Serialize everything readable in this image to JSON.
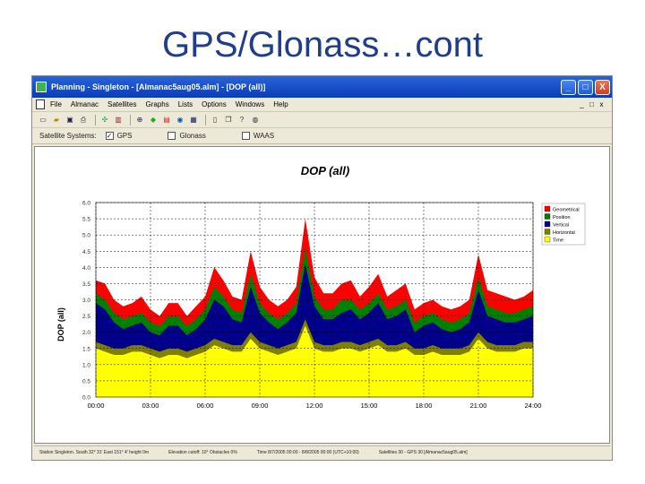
{
  "slide": {
    "title": "GPS/Glonass…cont"
  },
  "window": {
    "title": "Planning - Singleton - [Almanac5aug05.alm] - [DOP (all)]",
    "controls": [
      "_",
      "□",
      "X"
    ]
  },
  "menu": {
    "items": [
      "File",
      "Almanac",
      "Satellites",
      "Graphs",
      "Lists",
      "Options",
      "Windows",
      "Help"
    ],
    "doc_controls": [
      "_",
      "□",
      "x"
    ]
  },
  "toolbar": {
    "icons": [
      "new-icon",
      "open-icon",
      "save-icon",
      "print-icon",
      "satellite-icon",
      "number-icon",
      "sky-plot-icon",
      "elevation-icon",
      "dop-icon",
      "world-view-icon",
      "table-icon",
      "tile-icon",
      "cascade-icon",
      "help-icon",
      "about-icon"
    ]
  },
  "options": {
    "label": "Satellite Systems:",
    "systems": [
      {
        "label": "GPS",
        "checked": true
      },
      {
        "label": "Glonass",
        "checked": false
      },
      {
        "label": "WAAS",
        "checked": false
      }
    ]
  },
  "status": {
    "station": "Station Singleton. South 32° 31'  East 151° 4'  height 0m",
    "cutoff": "Elevation cutoff: 10°  Obstacles 0%",
    "time": "Time 8/7/2005 00:00 - 8/8/2005 00:00 (UTC+10:00)",
    "satellites": "Satellites 30 - GPS 30 [Almanac5aug05.alm]"
  },
  "chart_data": {
    "type": "area",
    "title": "DOP (all)",
    "xlabel": "",
    "ylabel": "DOP (all)",
    "x_ticks": [
      "00:00",
      "03:00",
      "06:00",
      "09:00",
      "12:00",
      "15:00",
      "18:00",
      "21:00",
      "24:00"
    ],
    "y_ticks": [
      "0.0",
      "0.5",
      "1.0",
      "1.5",
      "2.0",
      "2.5",
      "3.0",
      "3.5",
      "4.0",
      "4.5",
      "5.0",
      "5.5",
      "6.0"
    ],
    "ylim": [
      0,
      6
    ],
    "grid": true,
    "legend_position": "top-right",
    "x_hours": [
      0,
      0.5,
      1,
      1.5,
      2,
      2.5,
      3,
      3.5,
      4,
      4.5,
      5,
      5.5,
      6,
      6.5,
      7,
      7.5,
      8,
      8.5,
      9,
      9.5,
      10,
      10.5,
      11,
      11.5,
      12,
      12.5,
      13,
      13.5,
      14,
      14.5,
      15,
      15.5,
      16,
      16.5,
      17,
      17.5,
      18,
      18.5,
      19,
      19.5,
      20,
      20.5,
      21,
      21.5,
      22,
      22.5,
      23,
      23.5,
      24
    ],
    "series": [
      {
        "name": "Geometrical",
        "color": "#ff0000",
        "values": [
          3.6,
          3.5,
          3.0,
          2.8,
          2.9,
          3.1,
          2.7,
          2.5,
          2.9,
          2.9,
          2.5,
          2.8,
          3.1,
          4.0,
          3.6,
          3.1,
          3.0,
          4.5,
          3.4,
          3.0,
          2.8,
          3.0,
          3.4,
          5.5,
          3.7,
          3.2,
          3.2,
          3.5,
          3.6,
          3.1,
          3.4,
          3.8,
          3.1,
          3.3,
          3.5,
          2.7,
          2.9,
          3.0,
          2.8,
          2.7,
          2.8,
          3.0,
          4.4,
          3.3,
          3.2,
          3.1,
          3.0,
          3.1,
          3.3
        ]
      },
      {
        "name": "Position",
        "color": "#008000",
        "values": [
          3.2,
          3.0,
          2.6,
          2.4,
          2.5,
          2.6,
          2.3,
          2.2,
          2.5,
          2.5,
          2.2,
          2.4,
          2.7,
          3.4,
          3.1,
          2.7,
          2.6,
          3.8,
          2.9,
          2.6,
          2.4,
          2.6,
          2.9,
          4.6,
          3.1,
          2.7,
          2.7,
          3.0,
          3.0,
          2.7,
          2.9,
          3.2,
          2.7,
          2.8,
          3.0,
          2.3,
          2.5,
          2.6,
          2.4,
          2.3,
          2.4,
          2.6,
          3.7,
          2.8,
          2.7,
          2.6,
          2.6,
          2.7,
          2.8
        ]
      },
      {
        "name": "Vertical",
        "color": "#00008b",
        "values": [
          2.9,
          2.7,
          2.3,
          2.1,
          2.2,
          2.3,
          2.0,
          1.9,
          2.2,
          2.2,
          1.9,
          2.1,
          2.4,
          3.0,
          2.8,
          2.4,
          2.3,
          3.4,
          2.6,
          2.3,
          2.1,
          2.3,
          2.6,
          4.1,
          2.8,
          2.4,
          2.4,
          2.6,
          2.7,
          2.4,
          2.6,
          2.9,
          2.4,
          2.5,
          2.7,
          2.0,
          2.2,
          2.3,
          2.1,
          2.0,
          2.1,
          2.3,
          3.3,
          2.5,
          2.4,
          2.3,
          2.3,
          2.4,
          2.5
        ]
      },
      {
        "name": "Horizontal",
        "color": "#808000",
        "values": [
          1.7,
          1.6,
          1.5,
          1.5,
          1.6,
          1.6,
          1.5,
          1.4,
          1.5,
          1.5,
          1.4,
          1.5,
          1.6,
          1.8,
          1.7,
          1.6,
          1.6,
          2.0,
          1.7,
          1.6,
          1.5,
          1.6,
          1.7,
          2.4,
          1.7,
          1.6,
          1.6,
          1.7,
          1.7,
          1.6,
          1.7,
          1.8,
          1.6,
          1.6,
          1.7,
          1.5,
          1.5,
          1.6,
          1.5,
          1.5,
          1.5,
          1.6,
          2.0,
          1.7,
          1.6,
          1.6,
          1.6,
          1.7,
          1.7
        ]
      },
      {
        "name": "Time",
        "color": "#ffff00",
        "values": [
          1.5,
          1.4,
          1.3,
          1.3,
          1.4,
          1.4,
          1.3,
          1.2,
          1.3,
          1.3,
          1.2,
          1.3,
          1.4,
          1.6,
          1.5,
          1.4,
          1.4,
          1.8,
          1.5,
          1.4,
          1.3,
          1.4,
          1.5,
          2.2,
          1.5,
          1.4,
          1.4,
          1.5,
          1.5,
          1.4,
          1.5,
          1.6,
          1.4,
          1.4,
          1.5,
          1.3,
          1.3,
          1.4,
          1.3,
          1.3,
          1.3,
          1.4,
          1.8,
          1.5,
          1.4,
          1.4,
          1.4,
          1.5,
          1.5
        ]
      }
    ]
  }
}
